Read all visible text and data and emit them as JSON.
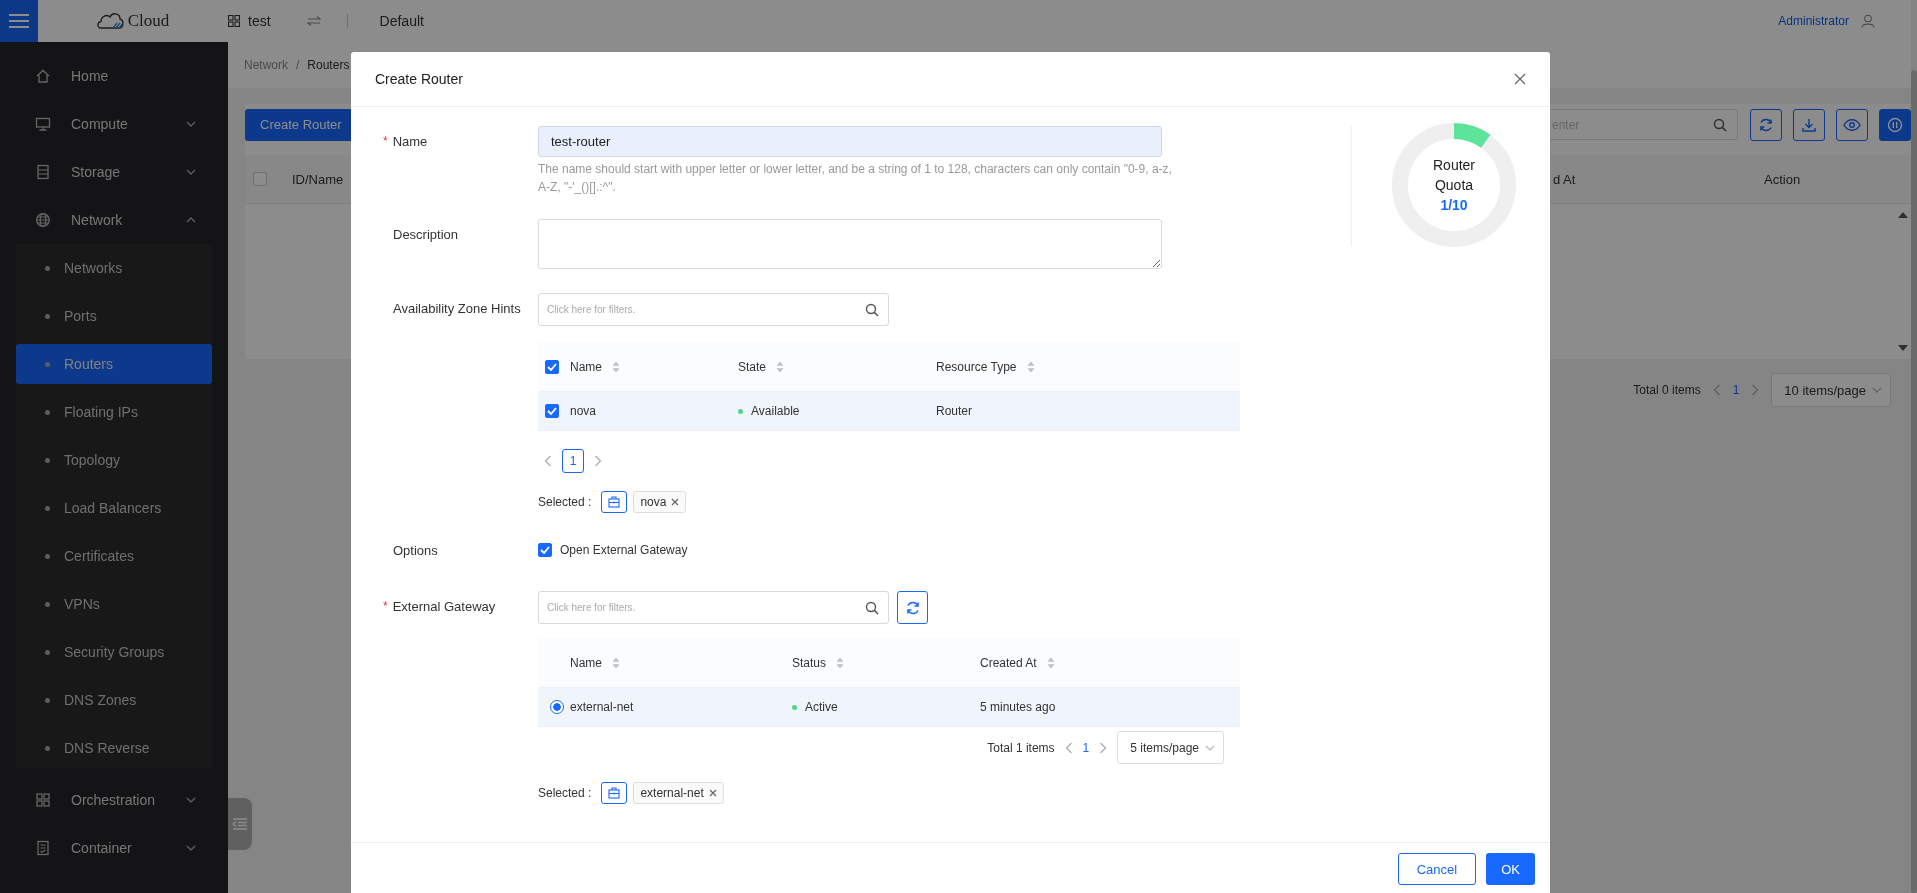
{
  "topbar": {
    "logo": "Cloud",
    "project": "test",
    "domain": "Default",
    "user": "Administrator"
  },
  "sidebar": {
    "items": [
      {
        "label": "Home",
        "kind": "link"
      },
      {
        "label": "Compute",
        "kind": "group",
        "expanded": false
      },
      {
        "label": "Storage",
        "kind": "group",
        "expanded": false
      },
      {
        "label": "Network",
        "kind": "group",
        "expanded": true,
        "children": [
          {
            "label": "Networks",
            "selected": false
          },
          {
            "label": "Ports",
            "selected": false
          },
          {
            "label": "Routers",
            "selected": true
          },
          {
            "label": "Floating IPs",
            "selected": false
          },
          {
            "label": "Topology",
            "selected": false
          },
          {
            "label": "Load Balancers",
            "selected": false
          },
          {
            "label": "Certificates",
            "selected": false
          },
          {
            "label": "VPNs",
            "selected": false
          },
          {
            "label": "Security Groups",
            "selected": false
          },
          {
            "label": "DNS Zones",
            "selected": false
          },
          {
            "label": "DNS Reverse",
            "selected": false
          }
        ]
      },
      {
        "label": "Orchestration",
        "kind": "group",
        "expanded": false
      },
      {
        "label": "Container",
        "kind": "group",
        "expanded": false
      }
    ]
  },
  "breadcrumb": {
    "items": [
      "Network",
      "Routers"
    ],
    "separator": "/"
  },
  "page": {
    "create_button": "Create Router",
    "search_placeholder": "enter",
    "all_checked": false,
    "columns": [
      "ID/Name",
      "d At",
      "Action"
    ],
    "total": "Total 0 items",
    "page": "1",
    "page_size": "10 items/page"
  },
  "modal": {
    "title": "Create Router",
    "name": {
      "label": "Name",
      "required_mark": "*",
      "value": "test-router",
      "help": "The name should start with upper letter or lower letter, and be a string of 1 to 128, characters can only contain \"0-9, a-z, A-Z, \"-'_()[].:^\"."
    },
    "description": {
      "label": "Description"
    },
    "availability_zone": {
      "label": "Availability Zone Hints",
      "placeholder": "Click here for filters.",
      "columns": [
        "Name",
        "State",
        "Resource Type"
      ],
      "all_checked": true,
      "rows": [
        {
          "name": "nova",
          "state": "Available",
          "color": "#52d48a",
          "resource_type": "Router",
          "checked": true
        }
      ],
      "pagination": {
        "kind": "boxed",
        "page": "1"
      },
      "selected_label": "Selected :",
      "selected_tags": [
        "nova"
      ]
    },
    "options": {
      "label": "Options",
      "checkbox": "Open External Gateway",
      "checked": true
    },
    "external_gateway": {
      "label": "External Gateway",
      "required_mark": "*",
      "placeholder": "Click here for filters.",
      "columns": [
        "Name",
        "Status",
        "Created At"
      ],
      "rows": [
        {
          "name": "external-net",
          "status": "Active",
          "color": "#52d48a",
          "created_at": "5 minutes ago",
          "selected": true
        }
      ],
      "pagination": {
        "kind": "full",
        "total": "Total 1 items",
        "page": "1",
        "page_size": "5 items/page"
      },
      "selected_label": "Selected :",
      "selected_tags": [
        "external-net"
      ]
    },
    "quota": {
      "line_1": "Router",
      "line_2": "Quota",
      "value": "1/10",
      "level": 0.1
    },
    "buttons": {
      "cancel": "Cancel",
      "ok": "OK"
    }
  }
}
